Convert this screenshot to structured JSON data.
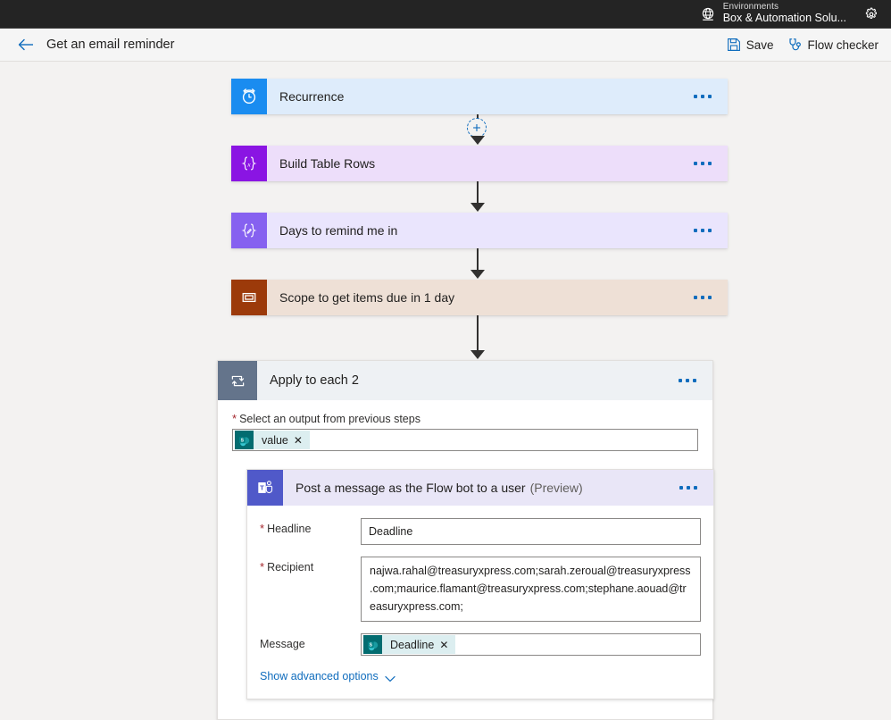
{
  "topbar": {
    "environment_label": "Environments",
    "environment_name": "Box & Automation Solu...",
    "globe_icon": "globe-icon",
    "settings_icon": "gear-icon"
  },
  "commandbar": {
    "back_icon": "back-arrow-icon",
    "title": "Get an email reminder",
    "save_label": "Save",
    "save_icon": "save-floppy-icon",
    "flow_checker_label": "Flow checker",
    "flow_checker_icon": "stethoscope-icon",
    "more_icon": "ellipsis-icon"
  },
  "flow": {
    "steps": [
      {
        "name": "recurrence",
        "title": "Recurrence",
        "subtitle": "",
        "icon": "alarm-clock-icon",
        "icon_bg": "#1a8cf0",
        "body_bg": "#deecfb"
      },
      {
        "name": "build-table-rows",
        "title": "Build Table Rows",
        "subtitle": "",
        "icon": "expression-braces-x-icon",
        "icon_bg": "#8a15e3",
        "body_bg": "#eddefa"
      },
      {
        "name": "days-to-remind-me-in",
        "title": "Days to remind me in",
        "subtitle": "",
        "icon": "expression-braces-pencil-icon",
        "icon_bg": "#8661f0",
        "body_bg": "#eae5fd"
      },
      {
        "name": "scope-to-get-items-due-in-1-day",
        "title": "Scope to get items due in 1 day",
        "subtitle": "",
        "icon": "scope-rectangle-icon",
        "icon_bg": "#9c3a0a",
        "body_bg": "#eee0d6"
      }
    ],
    "apply_to_each": {
      "title": "Apply to each 2",
      "icon": "loop-foreach-icon",
      "field_label": "Select an output from previous steps",
      "field_required": true,
      "token": {
        "text": "value",
        "icon": "sharepoint-icon",
        "remove_icon": "remove-token-icon"
      },
      "action": {
        "title": "Post a message as the Flow bot to a user",
        "subtitle": "(Preview)",
        "icon": "microsoft-teams-icon",
        "fields": [
          {
            "name": "headline",
            "label": "Headline",
            "required": true,
            "type": "text",
            "value": "Deadline"
          },
          {
            "name": "recipient",
            "label": "Recipient",
            "required": true,
            "type": "multiline",
            "value": "najwa.rahal@treasuryxpress.com;sarah.zeroual@treasuryxpress.com;maurice.flamant@treasuryxpress.com;stephane.aouad@treasuryxpress.com;"
          },
          {
            "name": "message",
            "label": "Message",
            "required": false,
            "type": "token",
            "token_text": "Deadline",
            "token_icon": "sharepoint-icon"
          }
        ],
        "advanced_options_label": "Show advanced options",
        "advanced_options_icon": "chevron-down-icon"
      }
    },
    "add_step_icon": "plus-circle-icon"
  },
  "colors": {
    "accent": "#0f6cbd",
    "required": "#a4262c",
    "canvas": "#f3f2f1",
    "topbar": "#242424"
  }
}
